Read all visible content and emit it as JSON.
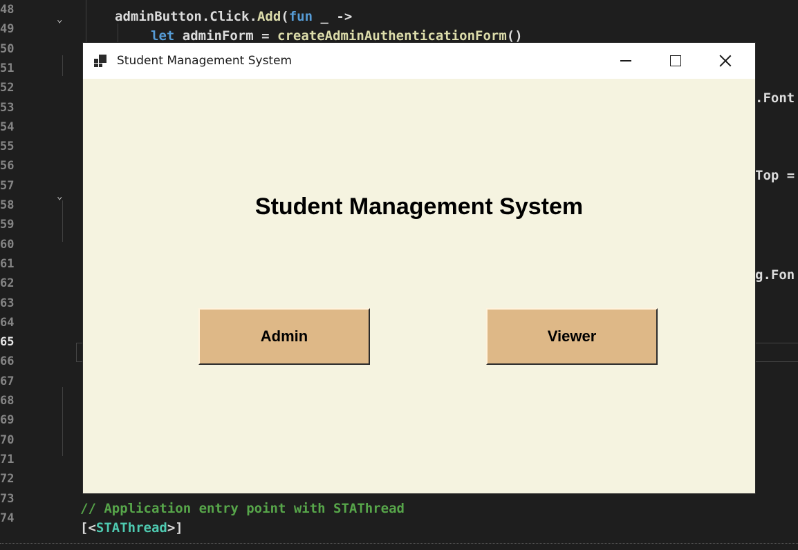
{
  "editor": {
    "line_numbers": [
      "48",
      "49",
      "50",
      "51",
      "52",
      "53",
      "54",
      "55",
      "56",
      "57",
      "58",
      "59",
      "60",
      "61",
      "62",
      "63",
      "64",
      "65",
      "66",
      "67",
      "68",
      "69",
      "70",
      "71",
      "72",
      "73",
      "74"
    ],
    "active_line": "65",
    "code": {
      "l48": {
        "obj": "adminButton",
        "dot1": ".",
        "member": "Click",
        "dot2": ".",
        "method": "Add",
        "paren": "(",
        "kw": "fun",
        "rest": " _ ->"
      },
      "l49": {
        "kw": "let",
        "name": " adminForm = ",
        "fn": "createAdminAuthenticationForm",
        "rest": "()"
      },
      "r52": ".Font",
      "r56": "Top =",
      "r61": "g.Fon",
      "l73": "// Application entry point with STAThread",
      "l74_open": "[<",
      "l74_type": "STAThread",
      "l74_close": ">]"
    }
  },
  "window": {
    "title": "Student Management System",
    "heading": "Student Management System",
    "buttons": {
      "admin": "Admin",
      "viewer": "Viewer"
    },
    "colors": {
      "client_bg": "#f5f3e0",
      "button_bg": "#deb887",
      "titlebar_bg": "#ffffff"
    }
  }
}
